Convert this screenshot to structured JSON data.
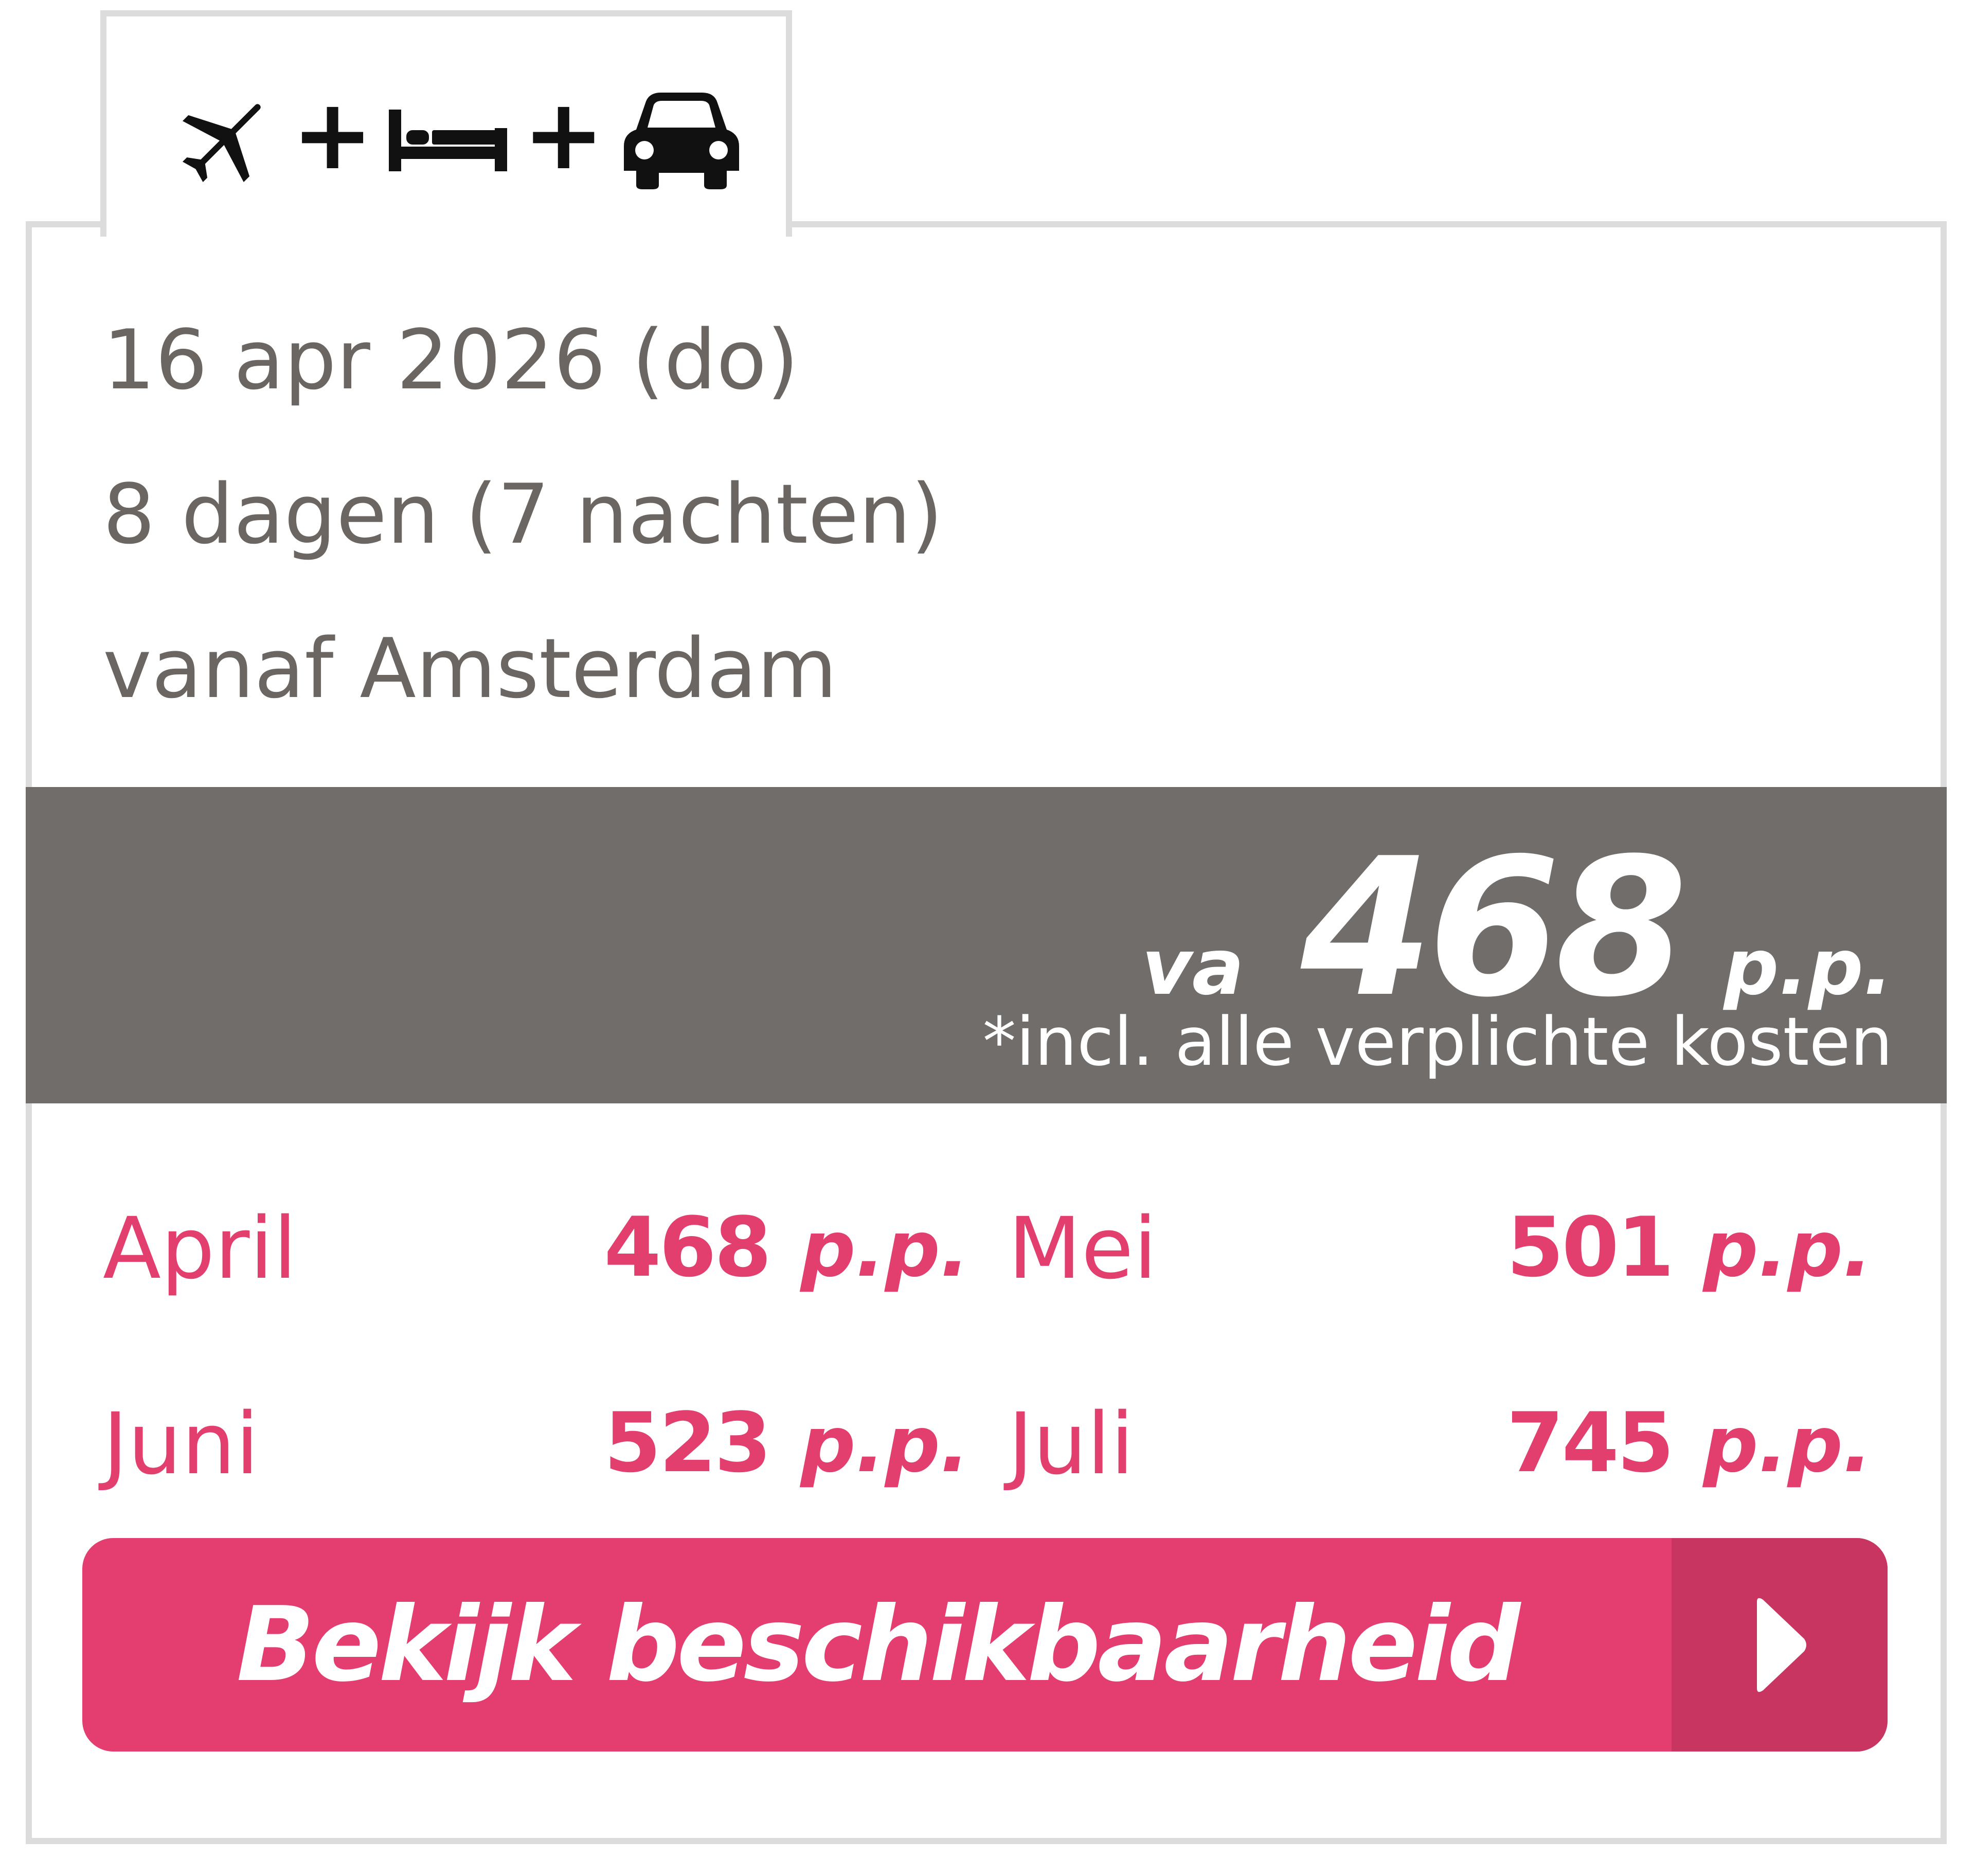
{
  "tab": {
    "icons": [
      "plane-icon",
      "bed-icon",
      "car-icon"
    ],
    "separator": "+"
  },
  "details": {
    "date": "16 apr 2026 (do)",
    "duration": "8 dagen (7 nachten)",
    "departure": "vanaf Amsterdam"
  },
  "price": {
    "prefix": "va",
    "amount": "468",
    "unit": "p.p.",
    "note": "*incl. alle verplichte kosten"
  },
  "months": [
    {
      "name": "April",
      "price": "468",
      "unit": "p.p."
    },
    {
      "name": "Mei",
      "price": "501",
      "unit": "p.p."
    },
    {
      "name": "Juni",
      "price": "523",
      "unit": "p.p."
    },
    {
      "name": "Juli",
      "price": "745",
      "unit": "p.p."
    }
  ],
  "cta": {
    "label": "Bekijk beschikbaarheid",
    "icon": "chevron-right-icon"
  },
  "colors": {
    "accent": "#e43e70",
    "accent_dark": "#c73560",
    "price_bar": "#716d6a",
    "text_gray": "#6b6662",
    "border": "#dcdcdc"
  }
}
